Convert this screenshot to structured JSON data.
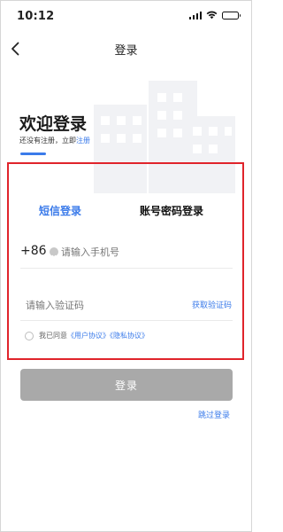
{
  "status_bar": {
    "time": "10:12",
    "icons": [
      "signal-icon",
      "wifi-icon",
      "battery-icon"
    ]
  },
  "nav": {
    "back_icon": "chevron-left-icon",
    "title": "登录"
  },
  "welcome": {
    "title": "欢迎登录",
    "register_prompt": "还没有注册，立即",
    "register_link": "注册"
  },
  "tabs": [
    {
      "label": "短信登录",
      "active": true
    },
    {
      "label": "账号密码登录",
      "active": false
    }
  ],
  "phone": {
    "country_code": "+86",
    "placeholder": "请输入手机号",
    "value": ""
  },
  "code": {
    "placeholder": "请输入验证码",
    "value": "",
    "get_code_label": "获取验证码"
  },
  "agreement": {
    "prefix": "我已同意",
    "user_agreement": "《用户协议》",
    "privacy_policy": "《隐私协议》",
    "checked": false
  },
  "actions": {
    "login_label": "登录",
    "skip_label": "跳过登录"
  },
  "colors": {
    "accent": "#3b7bea",
    "highlight_border": "#e0242b",
    "button_disabled": "#a9a9a9"
  }
}
